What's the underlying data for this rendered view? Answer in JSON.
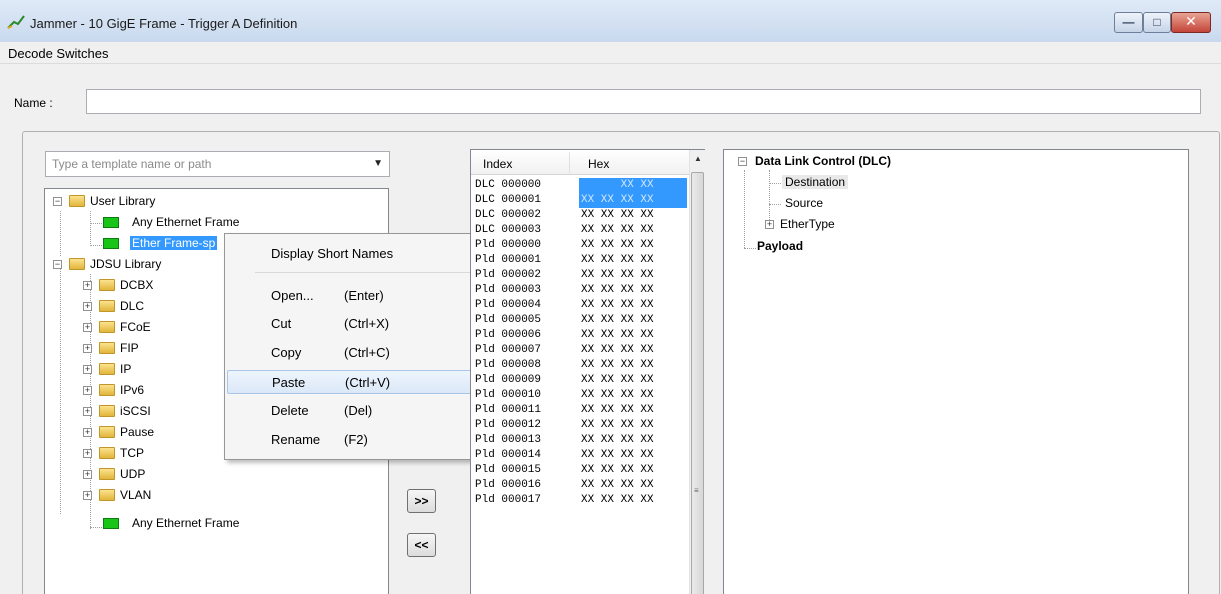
{
  "window": {
    "title": "Jammer - 10 GigE Frame - Trigger A Definition",
    "icon": "jammer-app-icon",
    "buttons": [
      "minimize-icon",
      "maximize-icon",
      "close-icon"
    ]
  },
  "menubar": {
    "decode_switches": "Decode Switches"
  },
  "name_field": {
    "label": "Name :",
    "value": ""
  },
  "template_combo": {
    "placeholder": "Type a template name or path"
  },
  "left_tree": {
    "user_library": "User Library",
    "user_items": [
      "Any Ethernet Frame",
      "Ether Frame-sp"
    ],
    "jdsu_library": "JDSU Library",
    "jdsu_folders": [
      "DCBX",
      "DLC",
      "FCoE",
      "FIP",
      "IP",
      "IPv6",
      "iSCSI",
      "Pause",
      "TCP",
      "UDP",
      "VLAN"
    ],
    "jdsu_leaf": "Any Ethernet Frame"
  },
  "context_menu": {
    "items": [
      {
        "label": "Display Short Names",
        "shortcut": ""
      },
      {
        "label": "Open...",
        "shortcut": "(Enter)"
      },
      {
        "label": "Cut",
        "shortcut": "(Ctrl+X)"
      },
      {
        "label": "Copy",
        "shortcut": "(Ctrl+C)"
      },
      {
        "label": "Paste",
        "shortcut": "(Ctrl+V)"
      },
      {
        "label": "Delete",
        "shortcut": "(Del)"
      },
      {
        "label": "Rename",
        "shortcut": "(F2)"
      }
    ],
    "hovered": "Paste"
  },
  "move_buttons": {
    "add": ">>",
    "remove": "<<"
  },
  "hex_grid": {
    "headers": [
      "Index",
      "Hex"
    ],
    "rows": [
      {
        "index": "DLC 000000",
        "hex": "      XX XX"
      },
      {
        "index": "DLC 000001",
        "hex": "XX XX XX XX"
      },
      {
        "index": "DLC 000002",
        "hex": "XX XX XX XX"
      },
      {
        "index": "DLC 000003",
        "hex": "XX XX XX XX"
      },
      {
        "index": "Pld 000000",
        "hex": "XX XX XX XX"
      },
      {
        "index": "Pld 000001",
        "hex": "XX XX XX XX"
      },
      {
        "index": "Pld 000002",
        "hex": "XX XX XX XX"
      },
      {
        "index": "Pld 000003",
        "hex": "XX XX XX XX"
      },
      {
        "index": "Pld 000004",
        "hex": "XX XX XX XX"
      },
      {
        "index": "Pld 000005",
        "hex": "XX XX XX XX"
      },
      {
        "index": "Pld 000006",
        "hex": "XX XX XX XX"
      },
      {
        "index": "Pld 000007",
        "hex": "XX XX XX XX"
      },
      {
        "index": "Pld 000008",
        "hex": "XX XX XX XX"
      },
      {
        "index": "Pld 000009",
        "hex": "XX XX XX XX"
      },
      {
        "index": "Pld 000010",
        "hex": "XX XX XX XX"
      },
      {
        "index": "Pld 000011",
        "hex": "XX XX XX XX"
      },
      {
        "index": "Pld 000012",
        "hex": "XX XX XX XX"
      },
      {
        "index": "Pld 000013",
        "hex": "XX XX XX XX"
      },
      {
        "index": "Pld 000014",
        "hex": "XX XX XX XX"
      },
      {
        "index": "Pld 000015",
        "hex": "XX XX XX XX"
      },
      {
        "index": "Pld 000016",
        "hex": "XX XX XX XX"
      },
      {
        "index": "Pld 000017",
        "hex": "XX XX XX XX"
      }
    ],
    "selected_rows": [
      0,
      1
    ]
  },
  "right_tree": {
    "dlc": "Data Link Control (DLC)",
    "dlc_children": [
      "Destination",
      "Source",
      "EtherType"
    ],
    "selected": "Destination",
    "payload": "Payload"
  },
  "colors": {
    "selection": "#3399ff",
    "window_bg": "#f0f0f0",
    "leaf_icon": "#19c419",
    "folder_icon": "#f2c94c"
  }
}
